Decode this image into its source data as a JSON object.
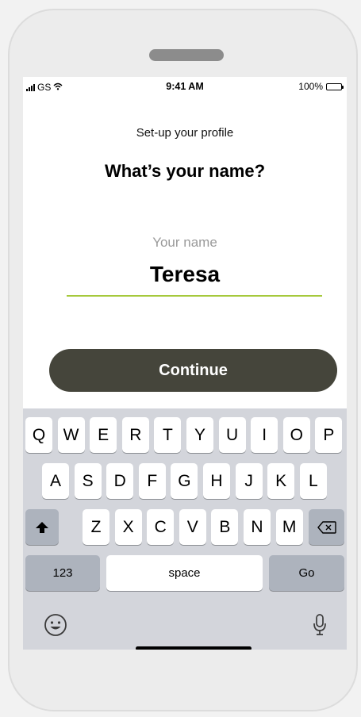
{
  "status_bar": {
    "carrier": "GS",
    "time": "9:41 AM",
    "battery": "100%"
  },
  "header": {
    "subtitle": "Set-up your profile",
    "title": "What’s your name?"
  },
  "name_field": {
    "label": "Your name",
    "value": "Teresa"
  },
  "continue_label": "Continue",
  "keyboard": {
    "row1": [
      "Q",
      "W",
      "E",
      "R",
      "T",
      "Y",
      "U",
      "I",
      "O",
      "P"
    ],
    "row2": [
      "A",
      "S",
      "D",
      "F",
      "G",
      "H",
      "J",
      "K",
      "L"
    ],
    "row3": [
      "Z",
      "X",
      "C",
      "V",
      "B",
      "N",
      "M"
    ],
    "numbers_label": "123",
    "space_label": "space",
    "go_label": "Go"
  },
  "colors": {
    "accent": "#a6c93c",
    "button": "#45453b",
    "keyboard_bg": "#d3d5db"
  },
  "icons": [
    "signal-icon",
    "wifi-icon",
    "battery-icon",
    "shift-icon",
    "backspace-icon",
    "emoji-icon",
    "microphone-icon"
  ]
}
